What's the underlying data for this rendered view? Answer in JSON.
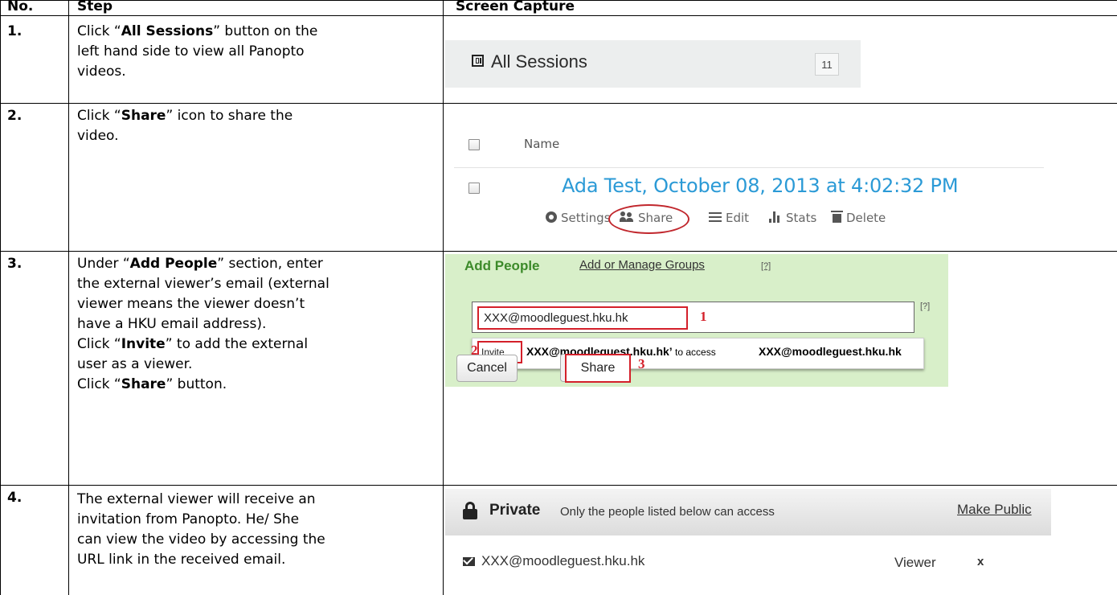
{
  "table": {
    "headers": {
      "no": "No.",
      "step": "Step",
      "capture": "Screen Capture"
    },
    "rows": [
      {
        "no": "1.",
        "lines": [
          {
            "pre": "Click “",
            "bold": "All Sessions",
            "post": "” button on the"
          },
          {
            "pre": "left hand side to view all Panopto",
            "bold": "",
            "post": ""
          },
          {
            "pre": "videos.",
            "bold": "",
            "post": ""
          }
        ]
      },
      {
        "no": "2.",
        "lines": [
          {
            "pre": "Click “",
            "bold": "Share",
            "post": "” icon to share the"
          },
          {
            "pre": "video.",
            "bold": "",
            "post": ""
          }
        ]
      },
      {
        "no": "3.",
        "lines": [
          {
            "pre": "Under “",
            "bold": "Add People",
            "post": "” section, enter"
          },
          {
            "pre": "the external viewer’s email (external",
            "bold": "",
            "post": ""
          },
          {
            "pre": "viewer means the viewer doesn’t",
            "bold": "",
            "post": ""
          },
          {
            "pre": "have a HKU email address).",
            "bold": "",
            "post": ""
          },
          {
            "pre": "Click “",
            "bold": "Invite",
            "post": "” to add the external"
          },
          {
            "pre": "user as a viewer.",
            "bold": "",
            "post": ""
          },
          {
            "pre": "Click “",
            "bold": "Share",
            "post": "” button."
          }
        ]
      },
      {
        "no": "4.",
        "lines": [
          {
            "pre": "The external viewer will receive an",
            "bold": "",
            "post": ""
          },
          {
            "pre": "invitation from Panopto. He/ She",
            "bold": "",
            "post": ""
          },
          {
            "pre": "can view the video by accessing the",
            "bold": "",
            "post": ""
          },
          {
            "pre": "URL link in the received email.",
            "bold": "",
            "post": ""
          }
        ]
      }
    ]
  },
  "capture1": {
    "label": "All Sessions",
    "count": "11",
    "icon": "sessions-icon"
  },
  "capture2": {
    "column_header": "Name",
    "session_title": "Ada Test, October 08, 2013 at 4:02:32 PM",
    "actions": [
      "Settings",
      "Share",
      "Edit",
      "Stats",
      "Delete"
    ],
    "highlight_color": "#c1272d"
  },
  "capture3": {
    "section_title": "Add People",
    "manage_link": "Add or Manage Groups",
    "help_mark": "[?]",
    "email_value": "XXX@moodleguest.hku.hk",
    "invite_label": "Invite",
    "invite_email": "XXX@moodleguest.hku.hk’",
    "invite_mid": " to access",
    "invite_email2": "XXX@moodleguest.hku.hk",
    "cancel_label": "Cancel",
    "share_label": "Share",
    "markers": [
      "1",
      "2",
      "3"
    ],
    "background": "#d8efc9"
  },
  "capture4": {
    "access_title": "Private",
    "access_desc": "Only the people listed below can access",
    "make_public": "Make Public",
    "viewer_email": "XXX@moodleguest.hku.hk",
    "viewer_role": "Viewer",
    "remove_label": "x"
  }
}
